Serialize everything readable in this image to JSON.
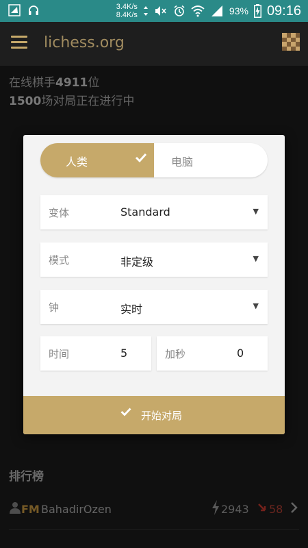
{
  "status_bar": {
    "upload_speed": "3.4K/s",
    "download_speed": "8.4K/s",
    "battery": "93%",
    "time": "09:16"
  },
  "app_bar": {
    "title": "lichess.org",
    "menu_icon": "hamburger-menu-icon",
    "board_icon": "chessboard-icon"
  },
  "background": {
    "online_players_prefix": "在线棋手",
    "online_players_count": "4911",
    "online_players_suffix": "位",
    "games_count": "1500",
    "games_suffix": "场对局正在进行中",
    "leaderboard_title": "排行榜",
    "leader": {
      "title_badge": "FM",
      "username": "BahadirOzen",
      "rating": "2943",
      "trend": "58"
    }
  },
  "dialog": {
    "opponent_tabs": {
      "human": "人类",
      "computer": "电脑",
      "selected": "human"
    },
    "variant": {
      "label": "变体",
      "value": "Standard"
    },
    "mode": {
      "label": "模式",
      "value": "非定级"
    },
    "clock": {
      "label": "钟",
      "value": "实时"
    },
    "time": {
      "label": "时间",
      "value": "5"
    },
    "increment": {
      "label": "加秒",
      "value": "0"
    },
    "start_button": "开始对局"
  },
  "colors": {
    "accent": "#c6a96a",
    "status_bar": "#2a8a88",
    "background": "#1a1a1a",
    "trend_down": "#a33a2f"
  }
}
